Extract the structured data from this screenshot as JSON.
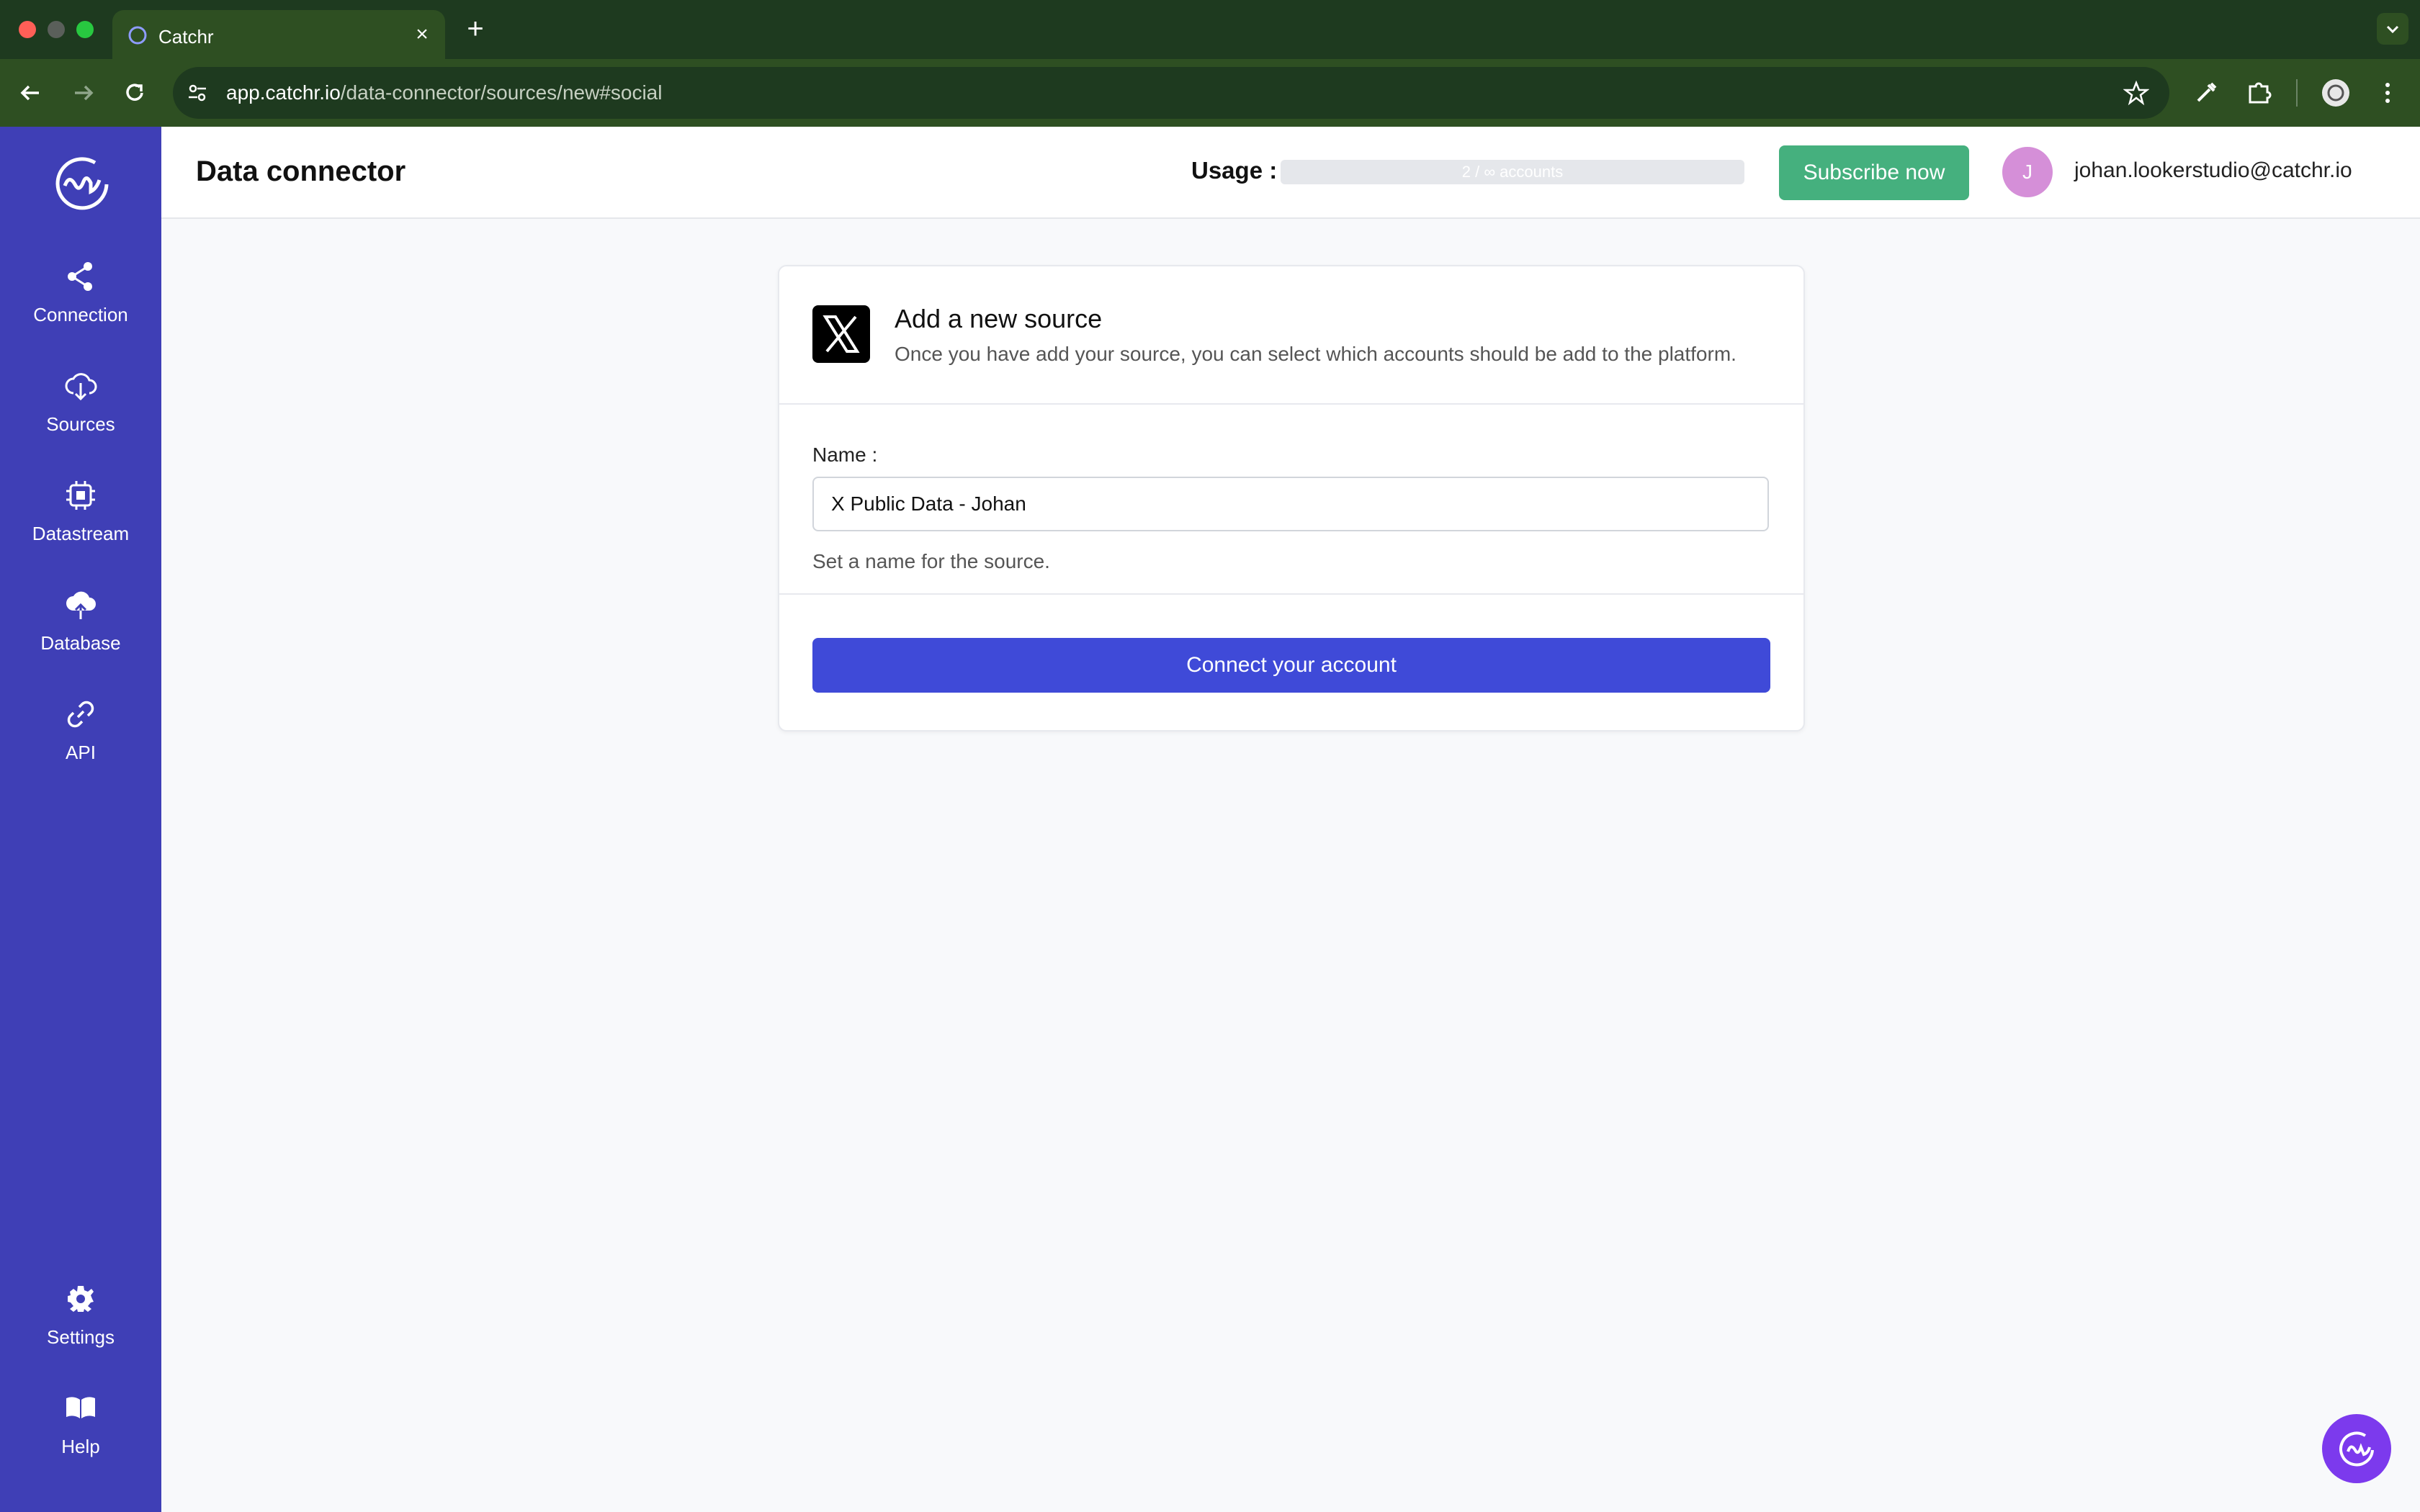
{
  "browser": {
    "tab_title": "Catchr",
    "url_host": "app.catchr.io",
    "url_path": "/data-connector/sources/new#social"
  },
  "header": {
    "title": "Data connector",
    "usage_label": "Usage :",
    "usage_text": "2 / ∞ accounts",
    "subscribe_label": "Subscribe now",
    "user_initial": "J",
    "user_email": "johan.lookerstudio@catchr.io"
  },
  "sidebar": {
    "items": [
      {
        "label": "Connection",
        "icon": "share-icon"
      },
      {
        "label": "Sources",
        "icon": "cloud-download-icon"
      },
      {
        "label": "Datastream",
        "icon": "chip-icon"
      },
      {
        "label": "Database",
        "icon": "cloud-upload-icon"
      },
      {
        "label": "API",
        "icon": "link-icon"
      },
      {
        "label": "Settings",
        "icon": "gear-icon"
      },
      {
        "label": "Help",
        "icon": "book-icon"
      }
    ]
  },
  "card": {
    "title": "Add a new source",
    "subtitle": "Once you have add your source, you can select which accounts should be add to the platform.",
    "name_label": "Name :",
    "name_value": "X Public Data - Johan",
    "help_text": "Set a name for the source.",
    "connect_label": "Connect your account"
  },
  "colors": {
    "sidebar": "#3f3fb6",
    "subscribe": "#45b07e",
    "connect": "#3f4ad8",
    "chrome": "#2e4f22"
  }
}
